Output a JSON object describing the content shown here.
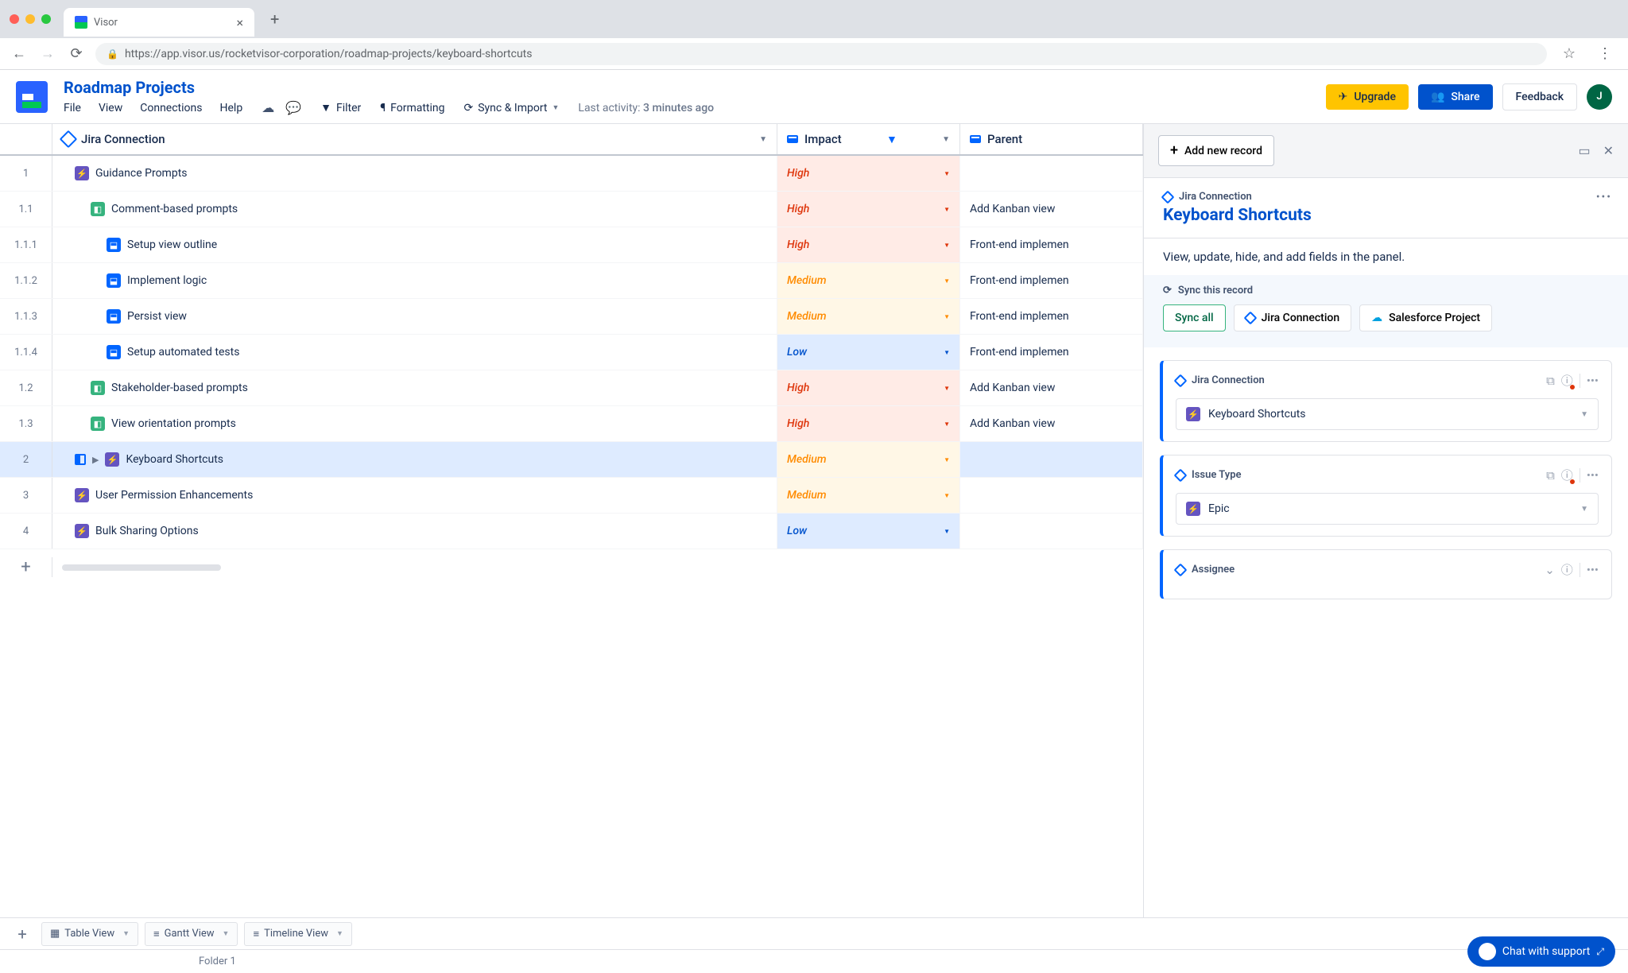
{
  "browser": {
    "tab_title": "Visor",
    "url": "https://app.visor.us/rocketvisor-corporation/roadmap-projects/keyboard-shortcuts"
  },
  "header": {
    "title": "Roadmap Projects",
    "menu": [
      "File",
      "View",
      "Connections",
      "Help"
    ],
    "actions": {
      "filter": "Filter",
      "formatting": "Formatting",
      "sync": "Sync & Import"
    },
    "last_activity_label": "Last activity: ",
    "last_activity_value": "3 minutes ago",
    "upgrade": "Upgrade",
    "share": "Share",
    "feedback": "Feedback",
    "avatar": "J"
  },
  "columns": {
    "jira": "Jira Connection",
    "impact": "Impact",
    "parent": "Parent"
  },
  "rows": [
    {
      "num": "1",
      "indent": 1,
      "icon": "purple",
      "glyph": "⚡",
      "title": "Guidance Prompts",
      "impact": "High",
      "parent": ""
    },
    {
      "num": "1.1",
      "indent": 2,
      "icon": "green",
      "glyph": "◧",
      "title": "Comment-based prompts",
      "impact": "High",
      "parent": "Add Kanban view"
    },
    {
      "num": "1.1.1",
      "indent": 3,
      "icon": "blue",
      "glyph": "⬓",
      "title": "Setup view outline",
      "impact": "High",
      "parent": "Front-end implemen"
    },
    {
      "num": "1.1.2",
      "indent": 3,
      "icon": "blue",
      "glyph": "⬓",
      "title": "Implement logic",
      "impact": "Medium",
      "parent": "Front-end implemen"
    },
    {
      "num": "1.1.3",
      "indent": 3,
      "icon": "blue",
      "glyph": "⬓",
      "title": "Persist view",
      "impact": "Medium",
      "parent": "Front-end implemen"
    },
    {
      "num": "1.1.4",
      "indent": 3,
      "icon": "blue",
      "glyph": "⬓",
      "title": "Setup automated tests",
      "impact": "Low",
      "parent": "Front-end implemen"
    },
    {
      "num": "1.2",
      "indent": 2,
      "icon": "green",
      "glyph": "◧",
      "title": "Stakeholder-based prompts",
      "impact": "High",
      "parent": "Add Kanban view"
    },
    {
      "num": "1.3",
      "indent": 2,
      "icon": "green",
      "glyph": "◧",
      "title": "View orientation  prompts",
      "impact": "High",
      "parent": "Add Kanban view"
    },
    {
      "num": "2",
      "indent": 1,
      "icon": "purple",
      "glyph": "⚡",
      "title": "Keyboard Shortcuts",
      "impact": "Medium",
      "parent": "",
      "selected": true,
      "expandable": true
    },
    {
      "num": "3",
      "indent": 1,
      "icon": "purple",
      "glyph": "⚡",
      "title": "User Permission Enhancements",
      "impact": "Medium",
      "parent": ""
    },
    {
      "num": "4",
      "indent": 1,
      "icon": "purple",
      "glyph": "⚡",
      "title": "Bulk Sharing Options",
      "impact": "Low",
      "parent": ""
    }
  ],
  "views": [
    {
      "icon": "▦",
      "label": "Table View"
    },
    {
      "icon": "≡",
      "label": "Gantt View"
    },
    {
      "icon": "≡",
      "label": "Timeline View"
    }
  ],
  "folder": "Folder 1",
  "panel": {
    "add_record": "Add new record",
    "breadcrumb": "Jira Connection",
    "title": "Keyboard Shortcuts",
    "subtitle": "View, update, hide, and add fields in the panel.",
    "sync_label": "Sync this record",
    "sync_all": "Sync all",
    "sync_jira": "Jira Connection",
    "sync_sf": "Salesforce Project",
    "fields": [
      {
        "label": "Jira Connection",
        "value": "Keyboard Shortcuts",
        "icon": "purple",
        "glyph": "⚡",
        "showAlert": true
      },
      {
        "label": "Issue Type",
        "value": "Epic",
        "icon": "purple",
        "glyph": "⚡",
        "showAlert": true
      },
      {
        "label": "Assignee",
        "value": "",
        "icon": "",
        "glyph": "",
        "showAlert": false
      }
    ]
  },
  "chat": "Chat with support"
}
